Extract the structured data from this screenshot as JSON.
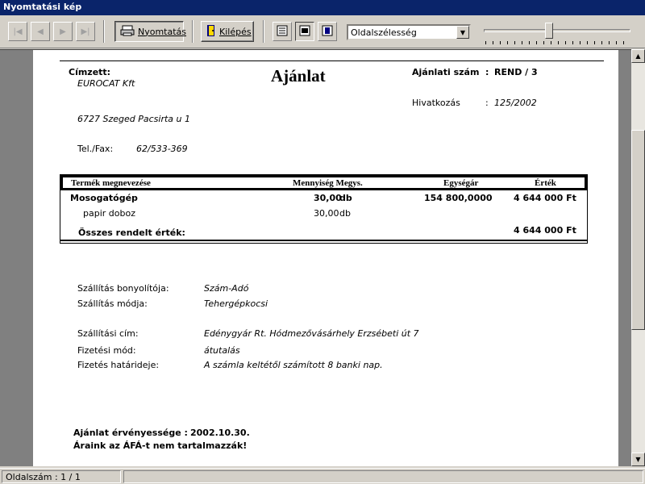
{
  "window": {
    "title": "Nyomtatási kép"
  },
  "toolbar": {
    "print_label": "Nyomtatás",
    "exit_label": "Kilépés",
    "zoom_value": "Oldalszélesség",
    "zoom_percent": 0.45
  },
  "status": {
    "page": "Oldalszám : 1 / 1"
  },
  "document": {
    "recipient_label": "Címzett:",
    "recipient_name": "EUROCAT Kft",
    "recipient_address": "6727 Szeged Pacsirta u 1",
    "telfax_label": "Tel./Fax:",
    "telfax_value": "62/533-369",
    "title": "Ajánlat",
    "offer_number_label": "Ajánlati szám",
    "offer_number_sep": ":",
    "offer_number_value": "REND / 3",
    "reference_label": "Hivatkozás",
    "reference_sep": ":",
    "reference_value": "125/2002",
    "table": {
      "headers": {
        "product": "Termék megnevezése",
        "quantity": "Mennyiség Megys.",
        "unit_price": "Egységár",
        "value": "Érték"
      },
      "rows": [
        {
          "product": "Mosogatógép",
          "quantity": "30,00",
          "unit": "db",
          "unit_price": "154 800,0000",
          "value": "4 644 000 Ft"
        },
        {
          "product": "papir doboz",
          "quantity": "30,00",
          "unit": "db",
          "unit_price": "",
          "value": ""
        }
      ],
      "total_label": "Összes rendelt érték:",
      "total_value": "4 644 000 Ft"
    },
    "details": [
      {
        "label": "Szállítás bonyolítója:",
        "value": "Szám-Adó"
      },
      {
        "label": "Szállítás módja:",
        "value": "Tehergépkocsi"
      },
      {
        "label": "Szállítási cím:",
        "value": "Edénygyár Rt. Hódmezővásárhely Erzsébeti út 7"
      },
      {
        "label": "Fizetési mód:",
        "value": "átutalás"
      },
      {
        "label": "Fizetés határideje:",
        "value": "A számla keltétől számított 8 banki nap."
      }
    ],
    "validity_label": "Ajánlat érvényessége :",
    "validity_value": "2002.10.30.",
    "vat_note": "Áraink az ÁFÁ-t nem tartalmazzák!"
  }
}
